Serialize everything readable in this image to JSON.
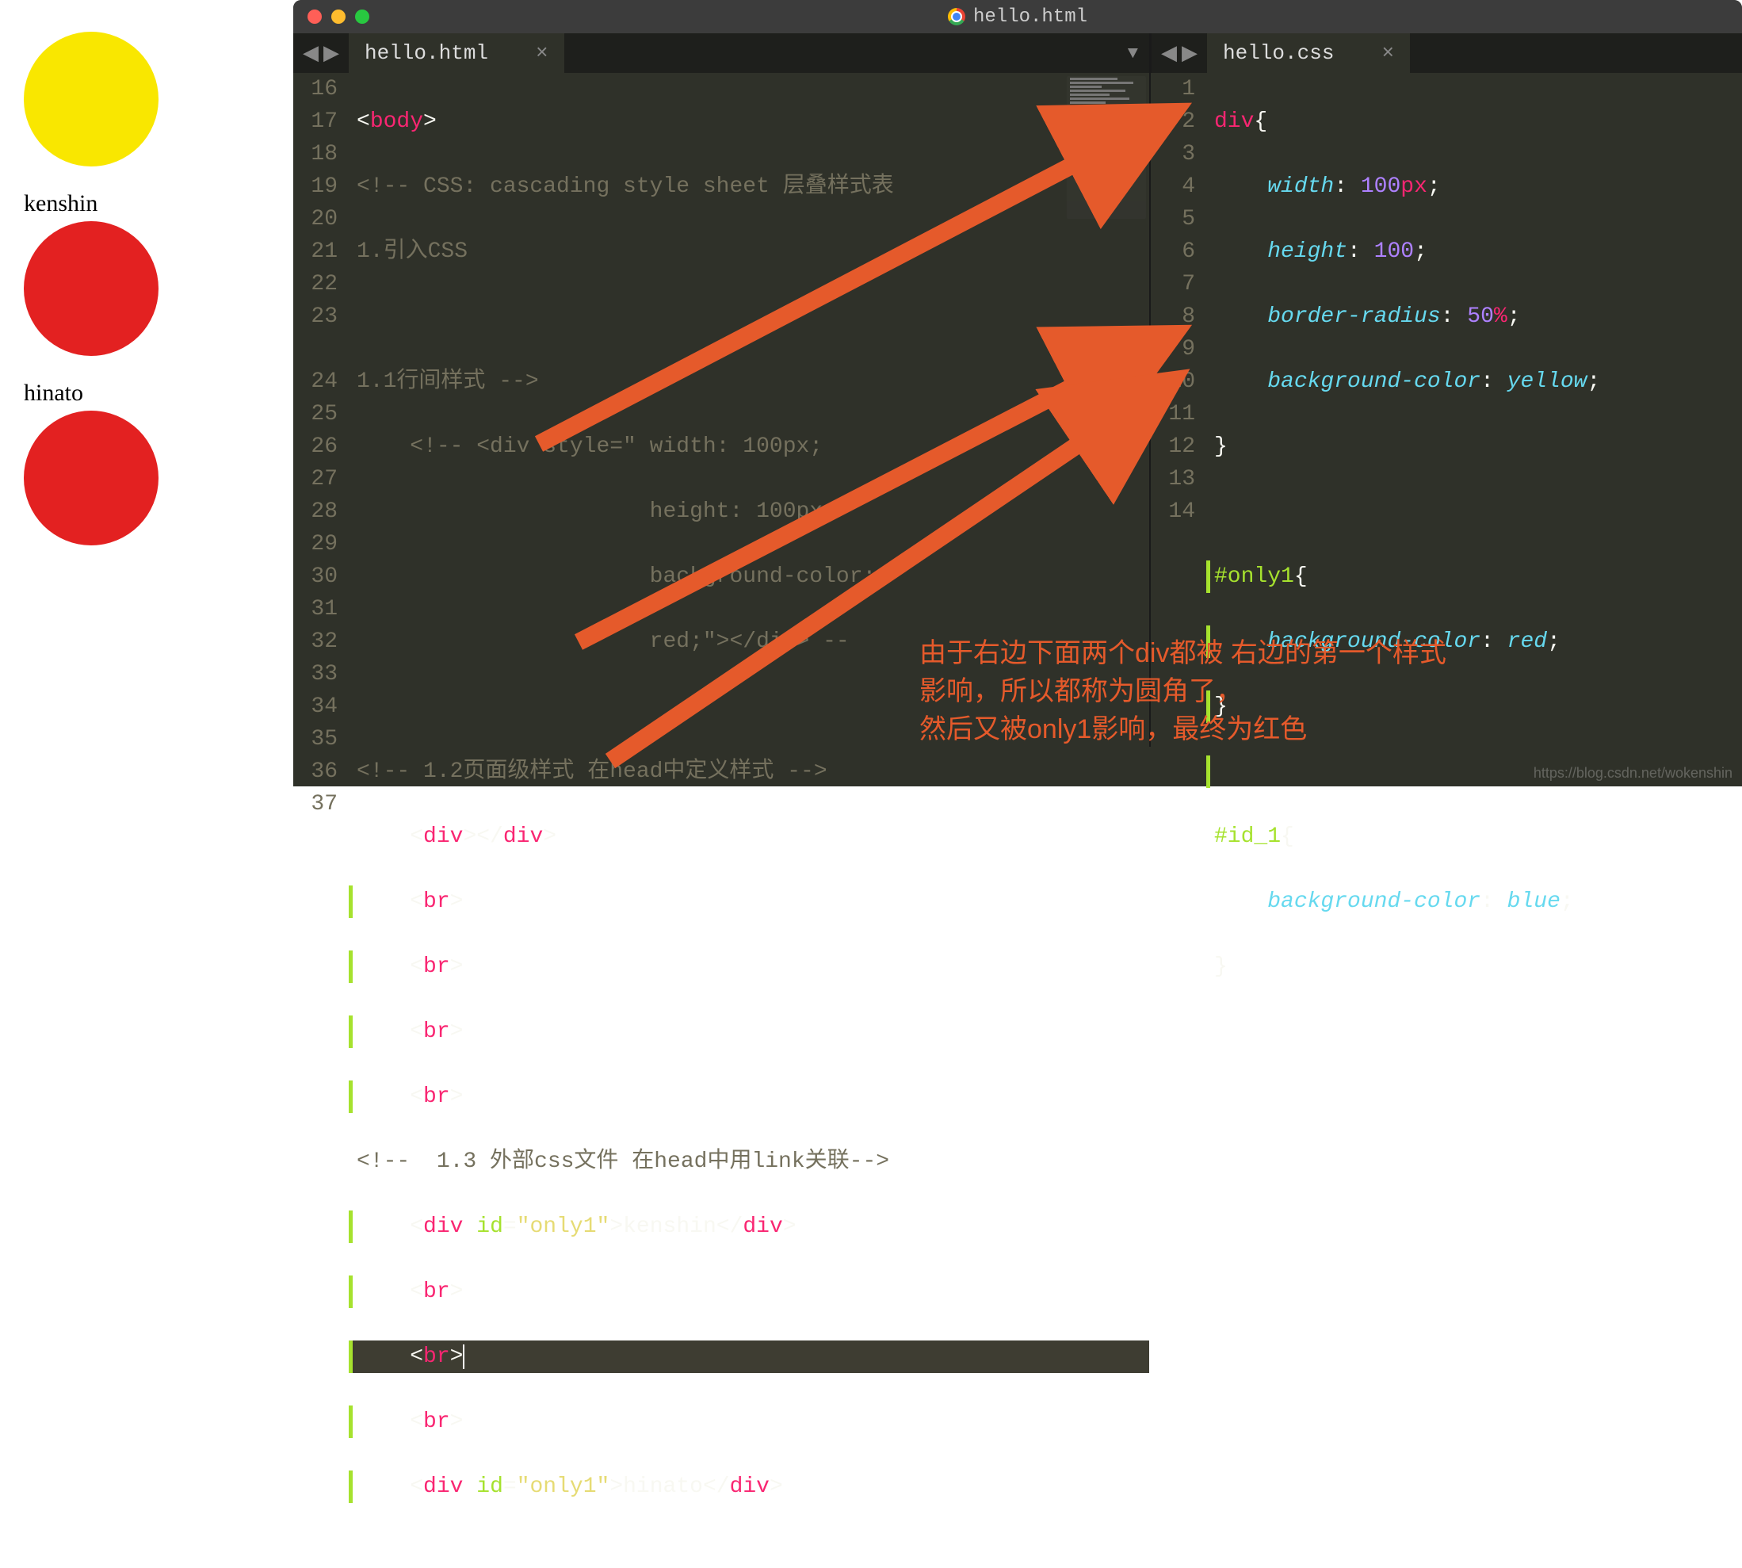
{
  "preview": {
    "label1": "kenshin",
    "label2": "hinato"
  },
  "window": {
    "title": "hello.html"
  },
  "tabs": {
    "left": {
      "name": "hello.html",
      "close": "×"
    },
    "right": {
      "name": "hello.css",
      "close": "×"
    }
  },
  "nav": {
    "left_arrow": "◀",
    "right_arrow": "▶",
    "dropdown": "▼"
  },
  "left_gutter": [
    "16",
    "17",
    "18",
    "19",
    "20",
    "21",
    "22",
    "23",
    "",
    "24",
    "25",
    "26",
    "27",
    "28",
    "29",
    "30",
    "31",
    "32",
    "33",
    "34",
    "35",
    "36",
    "37"
  ],
  "right_gutter": [
    "1",
    "2",
    "3",
    "4",
    "5",
    "6",
    "7",
    "8",
    "9",
    "10",
    "11",
    "12",
    "13",
    "14"
  ],
  "html_code": {
    "l16_open": "<",
    "l16_tag": "body",
    "l16_close": ">",
    "l17": "<!-- CSS: cascading style sheet 层叠样式表",
    "l18": "1.引入CSS",
    "l19": "",
    "l20": "1.1行间样式 -->",
    "l21": "    <!-- <div style=\" width: 100px;",
    "l22": "                      height: 100px;",
    "l23": "                      background-color:",
    "l23b": "                      red;\"></div> --",
    "l24": "",
    "l25": "<!-- 1.2页面级样式 在head中定义样式 -->",
    "l26_indent": "    ",
    "l26_open": "<",
    "l26_tag": "div",
    "l26_mid": "></",
    "l26_close": ">",
    "l27_indent": "    ",
    "l27_open": "<",
    "l27_tag": "br",
    "l27_close": ">",
    "l31": "<!--  1.3 外部css文件 在head中用link关联-->",
    "l32_indent": "    ",
    "l32_open": "<",
    "l32_tag": "div",
    "l32_sp": " ",
    "l32_attr": "id",
    "l32_eq": "=",
    "l32_val": "\"only1\"",
    "l32_mid": ">",
    "l32_text": "kenshin",
    "l32_co": "</",
    "l32_cc": ">",
    "l36_text": "hinato"
  },
  "css_code": {
    "l1_sel": "div",
    "l1_brace": "{",
    "l2_prop": "width",
    "l2_colon": ": ",
    "l2_val": "100",
    "l2_unit": "px",
    "l2_semi": ";",
    "l3_prop": "height",
    "l3_val": "100",
    "l4_prop": "border-radius",
    "l4_val": "50",
    "l4_unit": "%",
    "l5_prop": "background-color",
    "l5_val": "yellow",
    "l6_brace": "}",
    "l8_sel": "#only1",
    "l9_prop": "background-color",
    "l9_val": "red",
    "l12_sel": "#id_1",
    "l13_prop": "background-color",
    "l13_val": "blue"
  },
  "annotation": {
    "line1": "由于右边下面两个div都被 右边的第一个样式",
    "line2": "影响，所以都称为圆角了，",
    "line3": "然后又被only1影响，最终为红色"
  },
  "watermark": "https://blog.csdn.net/wokenshin"
}
